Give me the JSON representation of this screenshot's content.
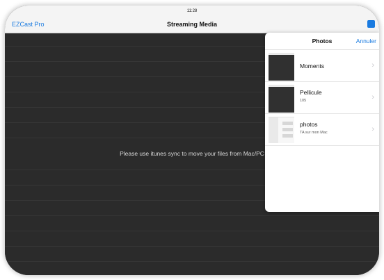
{
  "statusbar": {
    "time": "11:28"
  },
  "navbar": {
    "back_label": "EZCast Pro",
    "title": "Streaming Media"
  },
  "content": {
    "message": "Please use itunes sync to move your files from Mac/PC"
  },
  "popover": {
    "title": "Photos",
    "cancel_label": "Annuler",
    "albums": [
      {
        "name": "Moments",
        "count": ""
      },
      {
        "name": "Pellicule",
        "count": "105"
      },
      {
        "name": "photos",
        "count": "TA sur mon Mac"
      }
    ]
  },
  "colors": {
    "accent": "#1a7be0",
    "background": "#2b2b2b"
  }
}
